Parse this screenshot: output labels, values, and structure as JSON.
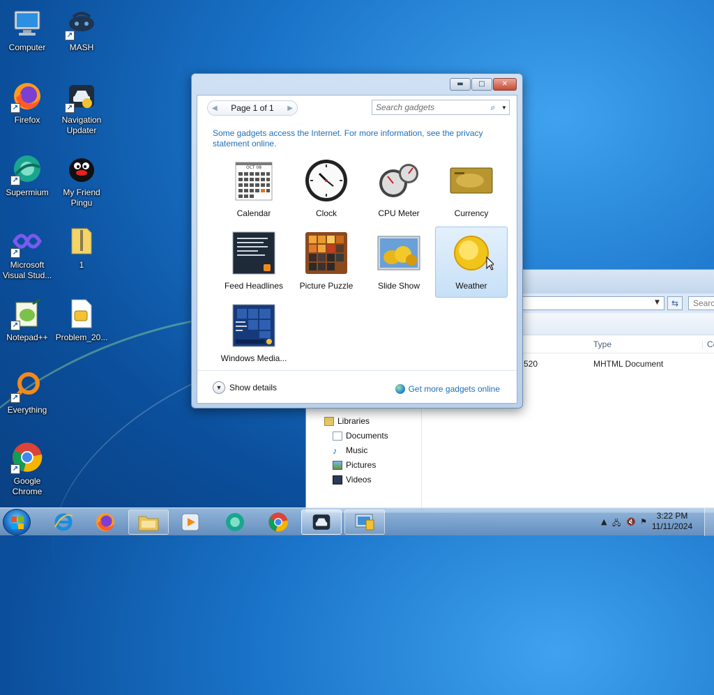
{
  "desktop": {
    "icons": [
      {
        "label": "Computer"
      },
      {
        "label": "MASH"
      },
      {
        "label": "Firefox"
      },
      {
        "label": "Navigation Updater"
      },
      {
        "label": "Supermium"
      },
      {
        "label": "My Friend Pingu"
      },
      {
        "label": "Microsoft Visual Stud..."
      },
      {
        "label": "1"
      },
      {
        "label": "Notepad++"
      },
      {
        "label": "Problem_20..."
      },
      {
        "label": "Everything"
      },
      {
        "label": "Google Chrome"
      }
    ]
  },
  "explorer": {
    "search_placeholder": "Searc",
    "columns": {
      "type": "Type",
      "co": "Co"
    },
    "row": {
      "size": "520",
      "type": "MHTML Document"
    },
    "nav": {
      "libraries": "Libraries",
      "documents": "Documents",
      "music": "Music",
      "pictures": "Pictures",
      "videos": "Videos"
    }
  },
  "gallery": {
    "pager": "Page 1 of 1",
    "search_placeholder": "Search gadgets",
    "info": "Some gadgets access the Internet.  For more information, see the privacy statement online.",
    "gadgets": [
      {
        "label": "Calendar",
        "icon": "calendar-icon"
      },
      {
        "label": "Clock",
        "icon": "clock-icon"
      },
      {
        "label": "CPU Meter",
        "icon": "cpu-meter-icon"
      },
      {
        "label": "Currency",
        "icon": "currency-icon"
      },
      {
        "label": "Feed Headlines",
        "icon": "feed-headlines-icon"
      },
      {
        "label": "Picture Puzzle",
        "icon": "picture-puzzle-icon"
      },
      {
        "label": "Slide Show",
        "icon": "slide-show-icon"
      },
      {
        "label": "Weather",
        "icon": "weather-icon",
        "selected": true
      },
      {
        "label": "Windows Media...",
        "icon": "windows-media-icon"
      }
    ],
    "calendar_month": "OCT 08",
    "show_details": "Show details",
    "get_more": "Get more gadgets online"
  },
  "taskbar": {
    "clock_time": "3:22 PM",
    "clock_date": "11/11/2024"
  },
  "colors": {
    "accent": "#1f6fb6",
    "selection": "#c7e0f7",
    "close_button": "#c74a31"
  }
}
